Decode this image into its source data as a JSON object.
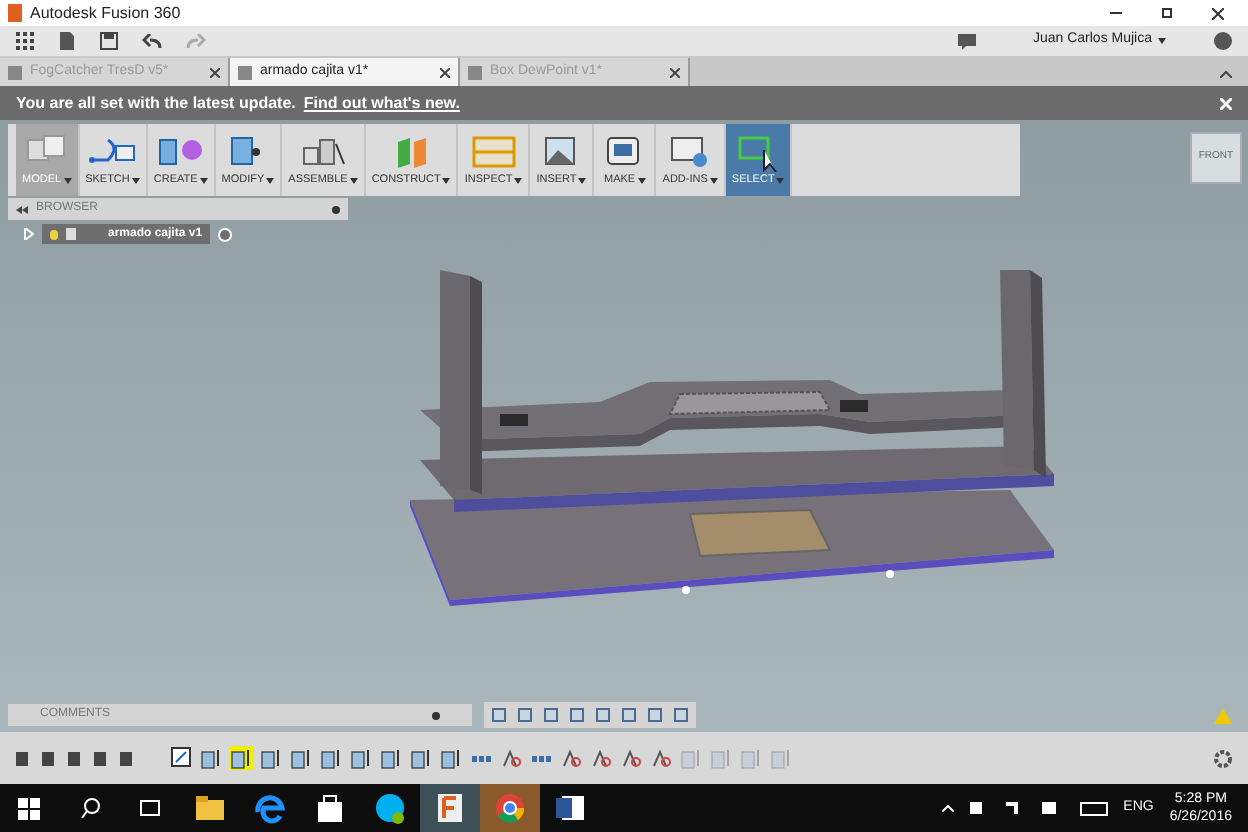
{
  "window": {
    "title": "Autodesk Fusion 360"
  },
  "menubar": {
    "user": "Juan Carlos Mujica"
  },
  "tabs": [
    {
      "label": "FogCatcher TresD v5*",
      "selected": false
    },
    {
      "label": "armado cajita v1*",
      "selected": true
    },
    {
      "label": "Box DewPoint v1*",
      "selected": false
    }
  ],
  "notification": {
    "text": "You are all set with the latest update.",
    "link": "Find out what's new."
  },
  "toolbar": [
    {
      "label": "MODEL",
      "kind": "model",
      "selected": false
    },
    {
      "label": "SKETCH",
      "kind": "sketch",
      "selected": false
    },
    {
      "label": "CREATE",
      "kind": "create",
      "selected": false
    },
    {
      "label": "MODIFY",
      "kind": "modify",
      "selected": false
    },
    {
      "label": "ASSEMBLE",
      "kind": "assemble",
      "selected": false
    },
    {
      "label": "CONSTRUCT",
      "kind": "construct",
      "selected": false
    },
    {
      "label": "INSPECT",
      "kind": "inspect",
      "selected": false
    },
    {
      "label": "INSERT",
      "kind": "insert",
      "selected": false
    },
    {
      "label": "MAKE",
      "kind": "make",
      "selected": false
    },
    {
      "label": "ADD-INS",
      "kind": "addins",
      "selected": false
    },
    {
      "label": "SELECT",
      "kind": "select",
      "selected": true
    }
  ],
  "viewcube": {
    "label": "FRONT"
  },
  "browser": {
    "title": "BROWSER",
    "items": [
      {
        "label": "armado cajita v1",
        "expanded": false
      }
    ]
  },
  "comments": {
    "title": "COMMENTS"
  },
  "timeline": [
    {
      "kind": "sketch",
      "selected": false,
      "rolled_back": false
    },
    {
      "kind": "extrude",
      "selected": false,
      "rolled_back": false
    },
    {
      "kind": "extrude",
      "selected": true,
      "rolled_back": false
    },
    {
      "kind": "extrude",
      "selected": false,
      "rolled_back": false
    },
    {
      "kind": "extrude",
      "selected": false,
      "rolled_back": false
    },
    {
      "kind": "extrude",
      "selected": false,
      "rolled_back": false
    },
    {
      "kind": "extrude",
      "selected": false,
      "rolled_back": false
    },
    {
      "kind": "extrude",
      "selected": false,
      "rolled_back": false
    },
    {
      "kind": "extrude",
      "selected": false,
      "rolled_back": false
    },
    {
      "kind": "extrude",
      "selected": false,
      "rolled_back": false
    },
    {
      "kind": "group",
      "selected": false,
      "rolled_back": false
    },
    {
      "kind": "joint",
      "selected": false,
      "rolled_back": false
    },
    {
      "kind": "group",
      "selected": false,
      "rolled_back": false
    },
    {
      "kind": "joint",
      "selected": false,
      "rolled_back": false
    },
    {
      "kind": "joint",
      "selected": false,
      "rolled_back": false
    },
    {
      "kind": "joint",
      "selected": false,
      "rolled_back": false
    },
    {
      "kind": "joint",
      "selected": false,
      "rolled_back": false
    },
    {
      "kind": "extrude",
      "selected": false,
      "rolled_back": true
    },
    {
      "kind": "extrude",
      "selected": false,
      "rolled_back": true
    },
    {
      "kind": "extrude",
      "selected": false,
      "rolled_back": true
    },
    {
      "kind": "extrude",
      "selected": false,
      "rolled_back": true
    }
  ],
  "taskbar": {
    "apps": [
      {
        "kind": "explorer",
        "active": false
      },
      {
        "kind": "edge",
        "active": false
      },
      {
        "kind": "store",
        "active": false
      },
      {
        "kind": "skype",
        "active": false
      },
      {
        "kind": "fusion",
        "active": true
      },
      {
        "kind": "chrome",
        "active": false
      },
      {
        "kind": "word",
        "active": false
      }
    ],
    "language": "ENG",
    "time": "5:28 PM",
    "date": "6/26/2016"
  }
}
